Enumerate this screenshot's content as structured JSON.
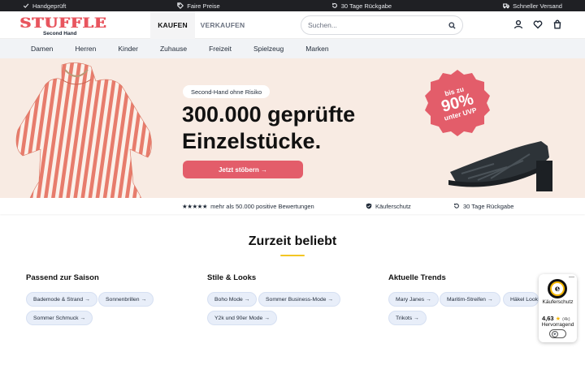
{
  "topbar": {
    "items": [
      {
        "label": "Handgeprüft",
        "icon": "check-icon"
      },
      {
        "label": "Faire Preise",
        "icon": "tag-icon"
      },
      {
        "label": "30 Tage Rückgabe",
        "icon": "return-icon"
      },
      {
        "label": "Schneller Versand",
        "icon": "truck-icon"
      }
    ]
  },
  "header": {
    "logo_word": "STUFFLE",
    "logo_sub": "Second Hand",
    "tabs": [
      {
        "label": "KAUFEN",
        "active": true
      },
      {
        "label": "VERKAUFEN",
        "active": false
      }
    ],
    "search_placeholder": "Suchen...",
    "icons": [
      "user-icon",
      "heart-icon",
      "bag-icon"
    ]
  },
  "nav": {
    "items": [
      "Damen",
      "Herren",
      "Kinder",
      "Zuhause",
      "Freizeit",
      "Spielzeug",
      "Marken"
    ]
  },
  "hero": {
    "pill": "Second-Hand ohne Risiko",
    "headline_line1": "300.000 geprüfte",
    "headline_line2": "Einzelstücke.",
    "cta": "Jetzt stöbern →",
    "badge_line1": "bis zu",
    "badge_line2": "90%",
    "badge_line3": "unter UVP",
    "colors": {
      "background": "#f8ebe3",
      "accent": "#e35d6a",
      "badge": "#e35d6a"
    }
  },
  "trust": {
    "rating_stars": "★★★★★",
    "rating_text": "mehr als 50.000 positive Bewertungen",
    "protection": "Käuferschutz",
    "returns": "30 Tage Rückgabe"
  },
  "trending": {
    "title": "Zurzeit beliebt",
    "columns": [
      {
        "title": "Passend zur Saison",
        "chips": [
          "Bademode & Strand →",
          "Sonnenbrillen →",
          "Sommer Schmuck →"
        ]
      },
      {
        "title": "Stile & Looks",
        "chips": [
          "Boho Mode →",
          "Sommer Business-Mode →",
          "Y2k und 90er Mode →"
        ]
      },
      {
        "title": "Aktuelle Trends",
        "chips": [
          "Mary Janes →",
          "Maritim-Streifen →",
          "Häkel Looks",
          "Trikots →"
        ]
      }
    ]
  },
  "trusted_widget": {
    "close": "—",
    "seal": "e",
    "label": "Käuferschutz",
    "rating": "4,63",
    "stars": "★",
    "count": "(4k)",
    "grade": "Hervorragend",
    "toggle": "e"
  }
}
